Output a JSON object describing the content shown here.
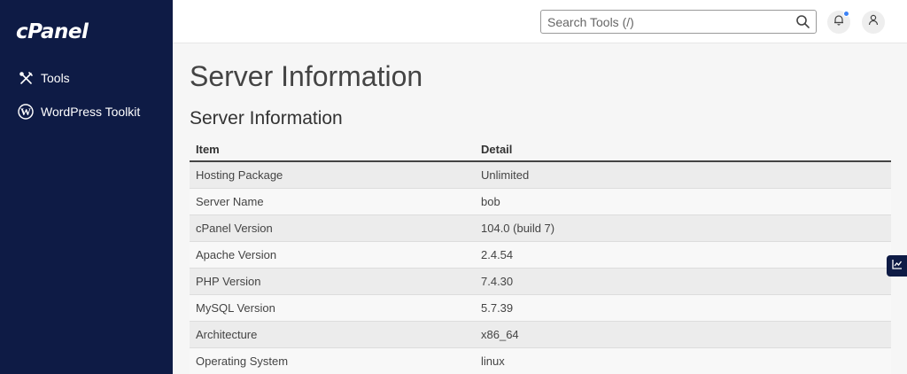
{
  "sidebar": {
    "logo": "cPanel",
    "items": [
      {
        "label": "Tools",
        "icon": "tools-icon"
      },
      {
        "label": "WordPress Toolkit",
        "icon": "wordpress-icon"
      }
    ]
  },
  "header": {
    "search_placeholder": "Search Tools (/)",
    "icons": [
      "search-icon",
      "bell-icon",
      "user-icon"
    ],
    "notification_dot_color": "#3b82f6"
  },
  "main": {
    "page_title": "Server Information",
    "section_title": "Server Information",
    "table": {
      "columns": [
        "Item",
        "Detail"
      ],
      "rows": [
        [
          "Hosting Package",
          "Unlimited"
        ],
        [
          "Server Name",
          "bob"
        ],
        [
          "cPanel Version",
          "104.0 (build 7)"
        ],
        [
          "Apache Version",
          "2.4.54"
        ],
        [
          "PHP Version",
          "7.4.30"
        ],
        [
          "MySQL Version",
          "5.7.39"
        ],
        [
          "Architecture",
          "x86_64"
        ],
        [
          "Operating System",
          "linux"
        ]
      ]
    }
  },
  "colors": {
    "sidebar_bg": "#0e1b45",
    "page_bg": "#f6f6f6"
  },
  "side_tab_icon": "chart-icon"
}
